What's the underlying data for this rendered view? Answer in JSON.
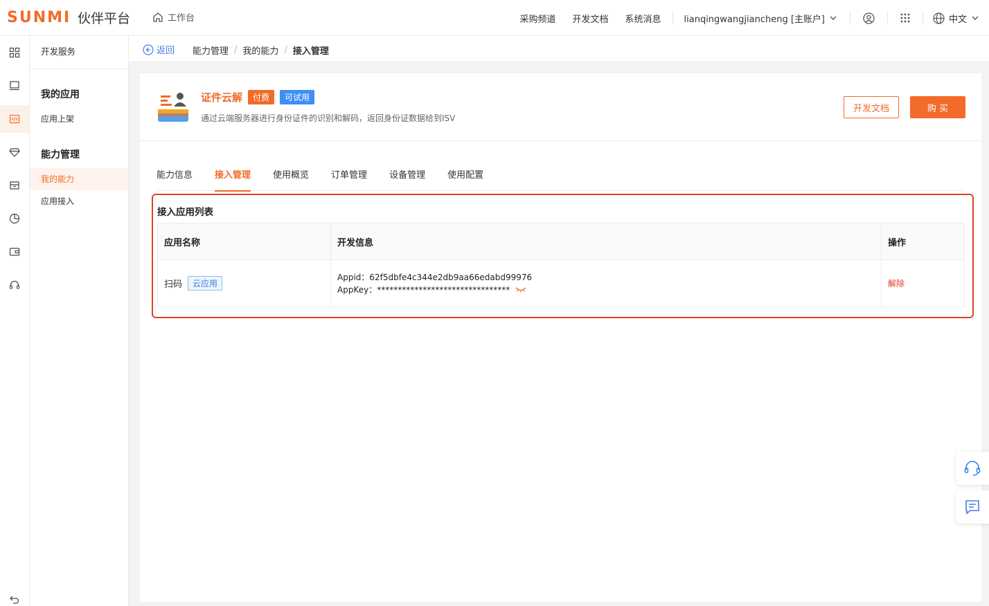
{
  "header": {
    "logo": "SUNMI",
    "platform": "伙伴平台",
    "workbench": "工作台",
    "nav": [
      "采购频道",
      "开发文档",
      "系统消息"
    ],
    "account": "lianqingwangjiancheng [主账户]",
    "language": "中文"
  },
  "sidebar": {
    "top": "开发服务",
    "groups": [
      {
        "title": "我的应用",
        "items": [
          "应用上架"
        ]
      },
      {
        "title": "能力管理",
        "items": [
          "我的能力",
          "应用接入"
        ]
      }
    ]
  },
  "breadcrumb": {
    "back": "返回",
    "items": [
      "能力管理",
      "我的能力",
      "接入管理"
    ]
  },
  "product": {
    "name": "证件云解",
    "tag_paid": "付费",
    "tag_trial": "可试用",
    "description": "通过云端服务器进行身份证件的识别和解码，返回身份证数据给到ISV",
    "btn_doc": "开发文档",
    "btn_buy": "购 买"
  },
  "tabs": [
    "能力信息",
    "接入管理",
    "使用概览",
    "订单管理",
    "设备管理",
    "使用配置"
  ],
  "section": {
    "title": "接入应用列表",
    "columns": [
      "应用名称",
      "开发信息",
      "操作"
    ],
    "rows": [
      {
        "app_name": "扫码",
        "app_tag": "云应用",
        "appid_label": "Appid：",
        "appid": "62f5dbfe4c344e2db9aa66edabd99976",
        "appkey_label": "AppKey：",
        "appkey": "********************************",
        "action": "解除"
      }
    ]
  },
  "colors": {
    "accent": "#f26b2a",
    "blue": "#3e8ef7",
    "danger": "#e0402a"
  }
}
